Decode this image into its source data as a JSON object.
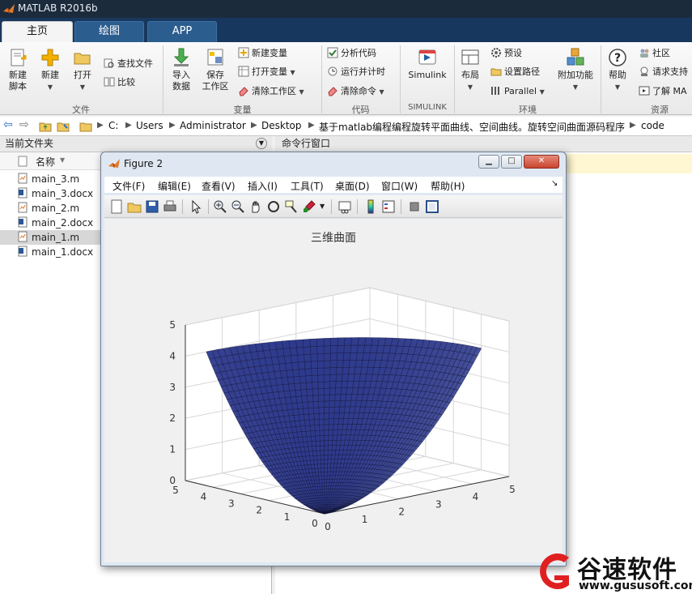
{
  "window": {
    "title": "MATLAB R2016b"
  },
  "tabs": [
    {
      "label": "主页",
      "active": true
    },
    {
      "label": "绘图",
      "active": false
    },
    {
      "label": "APP",
      "active": false
    }
  ],
  "ribbon": {
    "file": {
      "new_script": "新建\n脚本",
      "new": "新建",
      "open": "打开",
      "find_files": "查找文件",
      "compare": "比较",
      "label": "文件"
    },
    "variable": {
      "import": "导入\n数据",
      "save_ws": "保存\n工作区",
      "new_var": "新建变量",
      "open_var": "打开变量",
      "clear_ws": "清除工作区",
      "label": "变量"
    },
    "code": {
      "analyze": "分析代码",
      "run_time": "运行并计时",
      "clear_cmd": "清除命令",
      "label": "代码"
    },
    "simulink": {
      "button": "Simulink",
      "label": "SIMULINK"
    },
    "environment": {
      "layout": "布局",
      "prefs": "预设",
      "set_path": "设置路径",
      "parallel": "Parallel",
      "addons": "附加功能",
      "label": "环境"
    },
    "resources": {
      "help": "帮助",
      "community": "社区",
      "support": "请求支持",
      "learn": "了解 MA",
      "label": "资源"
    }
  },
  "address": {
    "crumbs": [
      "C:",
      "Users",
      "Administrator",
      "Desktop",
      "基于matlab编程编程旋转平面曲线、空间曲线。旋转空间曲面源码程序",
      "code"
    ]
  },
  "left_panel": {
    "header": "当前文件夹",
    "col_name": "名称",
    "files": [
      {
        "name": "main_3.m",
        "type": "m",
        "selected": false
      },
      {
        "name": "main_3.docx",
        "type": "docx",
        "selected": false
      },
      {
        "name": "main_2.m",
        "type": "m",
        "selected": false
      },
      {
        "name": "main_2.docx",
        "type": "docx",
        "selected": false
      },
      {
        "name": "main_1.m",
        "type": "m",
        "selected": true
      },
      {
        "name": "main_1.docx",
        "type": "docx",
        "selected": false
      }
    ]
  },
  "command_window": {
    "header": "命令行窗口"
  },
  "figure": {
    "title": "Figure 2",
    "menu": [
      "文件(F)",
      "编辑(E)",
      "查看(V)",
      "插入(I)",
      "工具(T)",
      "桌面(D)",
      "窗口(W)",
      "帮助(H)"
    ],
    "plot": {
      "title": "三维曲面",
      "z_ticks": [
        "0",
        "1",
        "2",
        "3",
        "4",
        "5"
      ],
      "x_ticks": [
        "0",
        "1",
        "2",
        "3",
        "4",
        "5"
      ],
      "y_ticks": [
        "0",
        "1",
        "2",
        "3",
        "4",
        "5"
      ],
      "surface_color": "#2e3a8c"
    }
  },
  "watermark": {
    "text": "谷速软件",
    "url": "www.gususoft.com",
    "color": "#e02020"
  }
}
